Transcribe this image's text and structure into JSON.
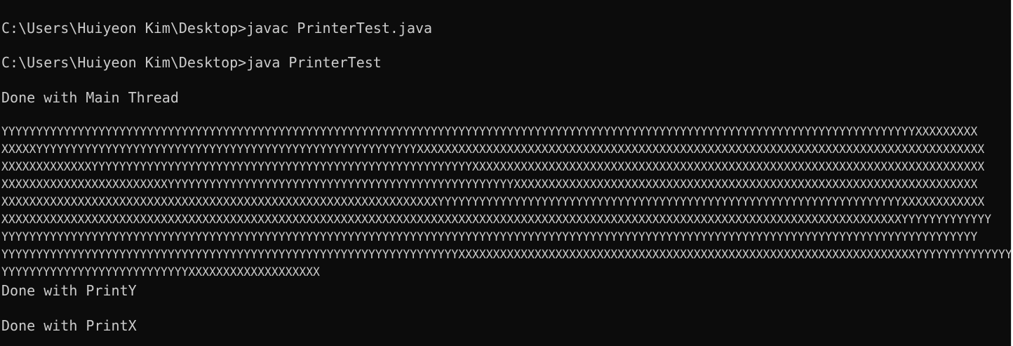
{
  "console": {
    "cmd1": "C:\\Users\\Huiyeon Kim\\Desktop>javac PrinterTest.java",
    "cmd2": "C:\\Users\\Huiyeon Kim\\Desktop>java PrinterTest",
    "main_done": "Done with Main Thread",
    "output_lines": [
      "YYYYYYYYYYYYYYYYYYYYYYYYYYYYYYYYYYYYYYYYYYYYYYYYYYYYYYYYYYYYYYYYYYYYYYYYYYYYYYYYYYYYYYYYYYYYYYYYYYYYYYYYYYYYYYYYYYYYYYYYYYYYYYYYYYYYXXXXXXXXX",
      "XXXXXYYYYYYYYYYYYYYYYYYYYYYYYYYYYYYYYYYYYYYYYYYYYYYYYYYYYYYYXXXXXXXXXXXXXXXXXXXXXXXXXXXXXXXXXXXXXXXXXXXXXXXXXXXXXXXXXXXXXXXXXXXXXXXXXXXXXXXXXX",
      "XXXXXXXXXXXXXYYYYYYYYYYYYYYYYYYYYYYYYYYYYYYYYYYYYYYYYYYYYYYYYYYYYYYYXXXXXXXXXXXXXXXXXXXXXXXXXXXXXXXXXXXXXXXXXXXXXXXXXXXXXXXXXXXXXXXXXXXXXXXXXX",
      "XXXXXXXXXXXXXXXXXXXXXXXXYYYYYYYYYYYYYYYYYYYYYYYYYYYYYYYYYYYYYYYYYYYYYYYYYYXXXXXXXXXXXXXXXXXXXXXXXXXXXXXXXXXXXXXXXXXXXXXXXXXXXXXXXXXXXXXXXXXXX",
      "XXXXXXXXXXXXXXXXXXXXXXXXXXXXXXXXXXXXXXXXXXXXXXXXXXXXXXXXXXXXXXXYYYYYYYYYYYYYYYYYYYYYYYYYYYYYYYYYYYYYYYYYYYYYYYYYYYYYYYYYYYYYYYYYYYXXXXXXXXXXXX",
      "XXXXXXXXXXXXXXXXXXXXXXXXXXXXXXXXXXXXXXXXXXXXXXXXXXXXXXXXXXXXXXXXXXXXXXXXXXXXXXXXXXXXXXXXXXXXXXXXXXXXXXXXXXXXXXXXXXXXXXXXXXXXXXXXXXYYYYYYYYYYYYY",
      "YYYYYYYYYYYYYYYYYYYYYYYYYYYYYYYYYYYYYYYYYYYYYYYYYYYYYYYYYYYYYYYYYYYYYYYYYYYYYYYYYYYYYYYYYYYYYYYYYYYYYYYYYYYYYYYYYYYYYYYYYYYYYYYYYYYYYYYYYYYYY",
      "YYYYYYYYYYYYYYYYYYYYYYYYYYYYYYYYYYYYYYYYYYYYYYYYYYYYYYYYYYYYYYYYYYXXXXXXXXXXXXXXXXXXXXXXXXXXXXXXXXXXXXXXXXXXXXXXXXXXXXXXXXXXXXXXXXXXYYYYYYYYYYYYYYYY",
      "YYYYYYYYYYYYYYYYYYYYYYYYYYYXXXXXXXXXXXXXXXXXXX"
    ],
    "printy_done": "Done with PrintY",
    "printx_done": "Done with PrintX"
  }
}
